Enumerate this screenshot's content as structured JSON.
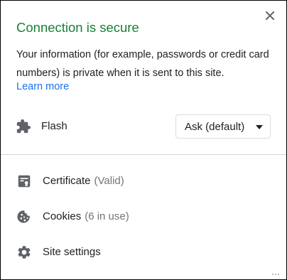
{
  "popup": {
    "title": "Connection is secure",
    "description": "Your information (for example, passwords or credit card numbers) is private when it is sent to this site.",
    "learn_more": "Learn more",
    "close_icon": "close-icon",
    "title_color": "#188038",
    "link_color": "#1a73e8"
  },
  "permissions": {
    "flash": {
      "icon": "puzzle-icon",
      "label": "Flash",
      "selected": "Ask (default)"
    }
  },
  "menu": {
    "certificate": {
      "icon": "certificate-icon",
      "label": "Certificate",
      "status": "(Valid)"
    },
    "cookies": {
      "icon": "cookie-icon",
      "label": "Cookies",
      "status": "(6 in use)"
    },
    "site_settings": {
      "icon": "gear-icon",
      "label": "Site settings"
    }
  }
}
